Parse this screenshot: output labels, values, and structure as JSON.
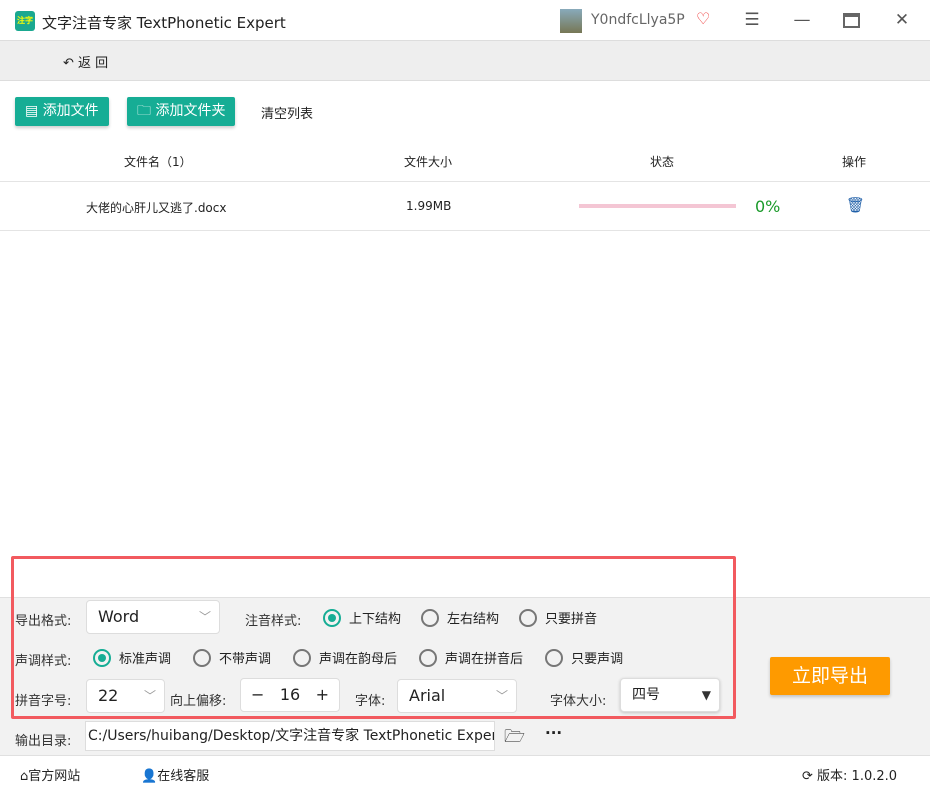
{
  "app": {
    "title": "文字注音专家 TextPhonetic Expert",
    "logo_text": "注字",
    "user": "Y0ndfcLlya5P"
  },
  "nav": {
    "back": "返 回"
  },
  "toolbar": {
    "add_file": "添加文件",
    "add_folder": "添加文件夹",
    "clear": "清空列表"
  },
  "table": {
    "headers": [
      "文件名（1）",
      "文件大小",
      "状态",
      "操作"
    ],
    "rows": [
      {
        "name": "大佬的心肝儿又逃了.docx",
        "size": "1.99MB",
        "progress_pct": "0%",
        "progress": 0
      }
    ]
  },
  "settings": {
    "export_format_label": "导出格式:",
    "export_format": "Word",
    "annotation_label": "注音样式:",
    "annotation_options": [
      "上下结构",
      "左右结构",
      "只要拼音"
    ],
    "tone_label": "声调样式:",
    "tone_options": [
      "标准声调",
      "不带声调",
      "声调在韵母后",
      "声调在拼音后",
      "只要声调"
    ],
    "pinyin_size_label": "拼音字号:",
    "pinyin_size": "22",
    "offset_label": "向上偏移:",
    "offset": "16",
    "minus": "−",
    "plus": "+",
    "font_label": "字体:",
    "font": "Arial",
    "font_size_label": "字体大小:",
    "font_size": "四号",
    "output_label": "输出目录:",
    "output_path": "C:/Users/huibang/Desktop/文字注音专家 TextPhonetic Expert",
    "more": "···",
    "export_button": "立即导出"
  },
  "footer": {
    "website": "官方网站",
    "support": "在线客服",
    "version": "版本:  1.0.2.0"
  }
}
